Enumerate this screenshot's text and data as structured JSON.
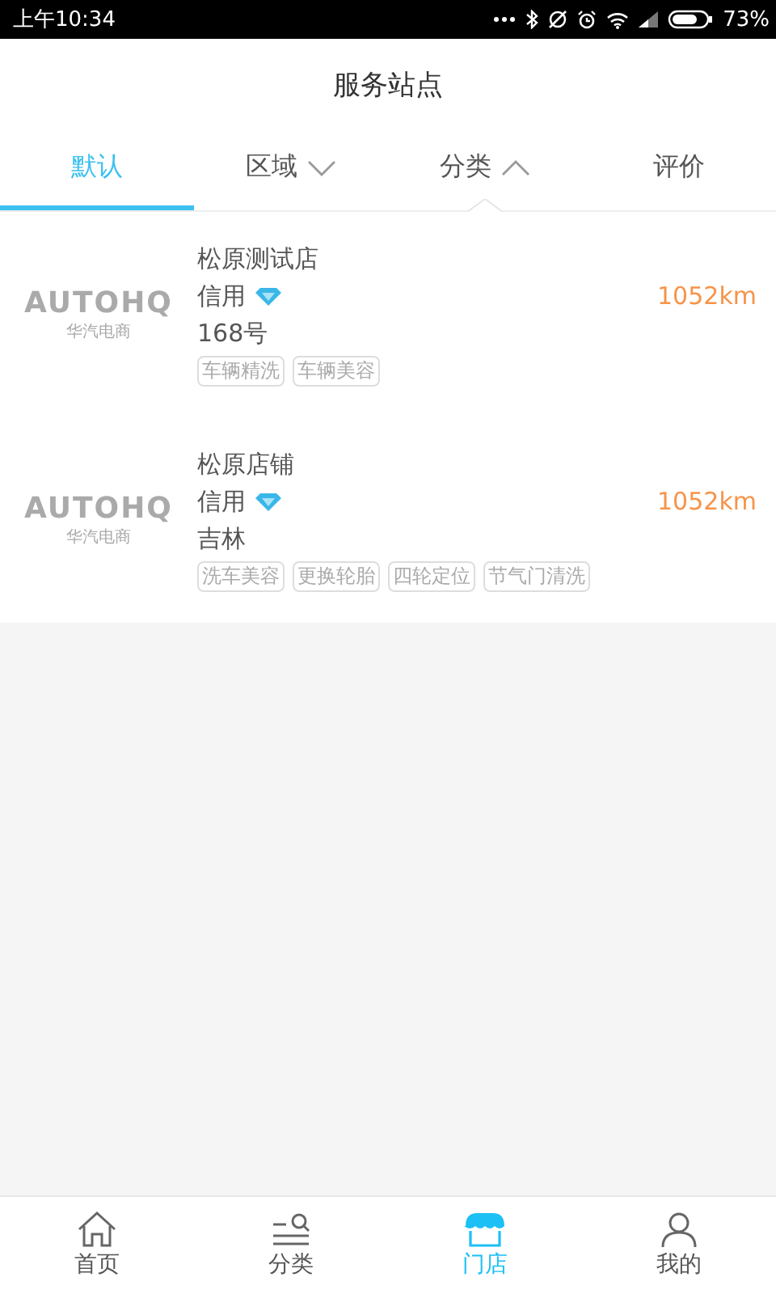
{
  "status_bar": {
    "time": "上午10:34",
    "battery": "73%"
  },
  "header": {
    "title": "服务站点"
  },
  "filters": [
    {
      "label": "默认",
      "selected": true,
      "kind": "plain"
    },
    {
      "label": "区域",
      "selected": false,
      "kind": "dropdown",
      "expanded": false
    },
    {
      "label": "分类",
      "selected": false,
      "kind": "dropdown",
      "expanded": true
    },
    {
      "label": "评价",
      "selected": false,
      "kind": "plain"
    }
  ],
  "stores": [
    {
      "logo": {
        "brand": "AUTOHQ",
        "subtitle": "华汽电商"
      },
      "name": "松原测试店",
      "credit": "信用",
      "distance": "1052km",
      "address": "168号",
      "tags": [
        "车辆精洗",
        "车辆美容"
      ]
    },
    {
      "logo": {
        "brand": "AUTOHQ",
        "subtitle": "华汽电商"
      },
      "name": "松原店铺",
      "credit": "信用",
      "distance": "1052km",
      "address": "吉林",
      "tags": [
        "洗车美容",
        "更换轮胎",
        "四轮定位",
        "节气门清洗"
      ]
    }
  ],
  "tab_bar": [
    {
      "label": "首页",
      "selected": false,
      "kind": "home"
    },
    {
      "label": "分类",
      "selected": false,
      "kind": "category"
    },
    {
      "label": "门店",
      "selected": true,
      "kind": "store"
    },
    {
      "label": "我的",
      "selected": false,
      "kind": "profile"
    }
  ]
}
